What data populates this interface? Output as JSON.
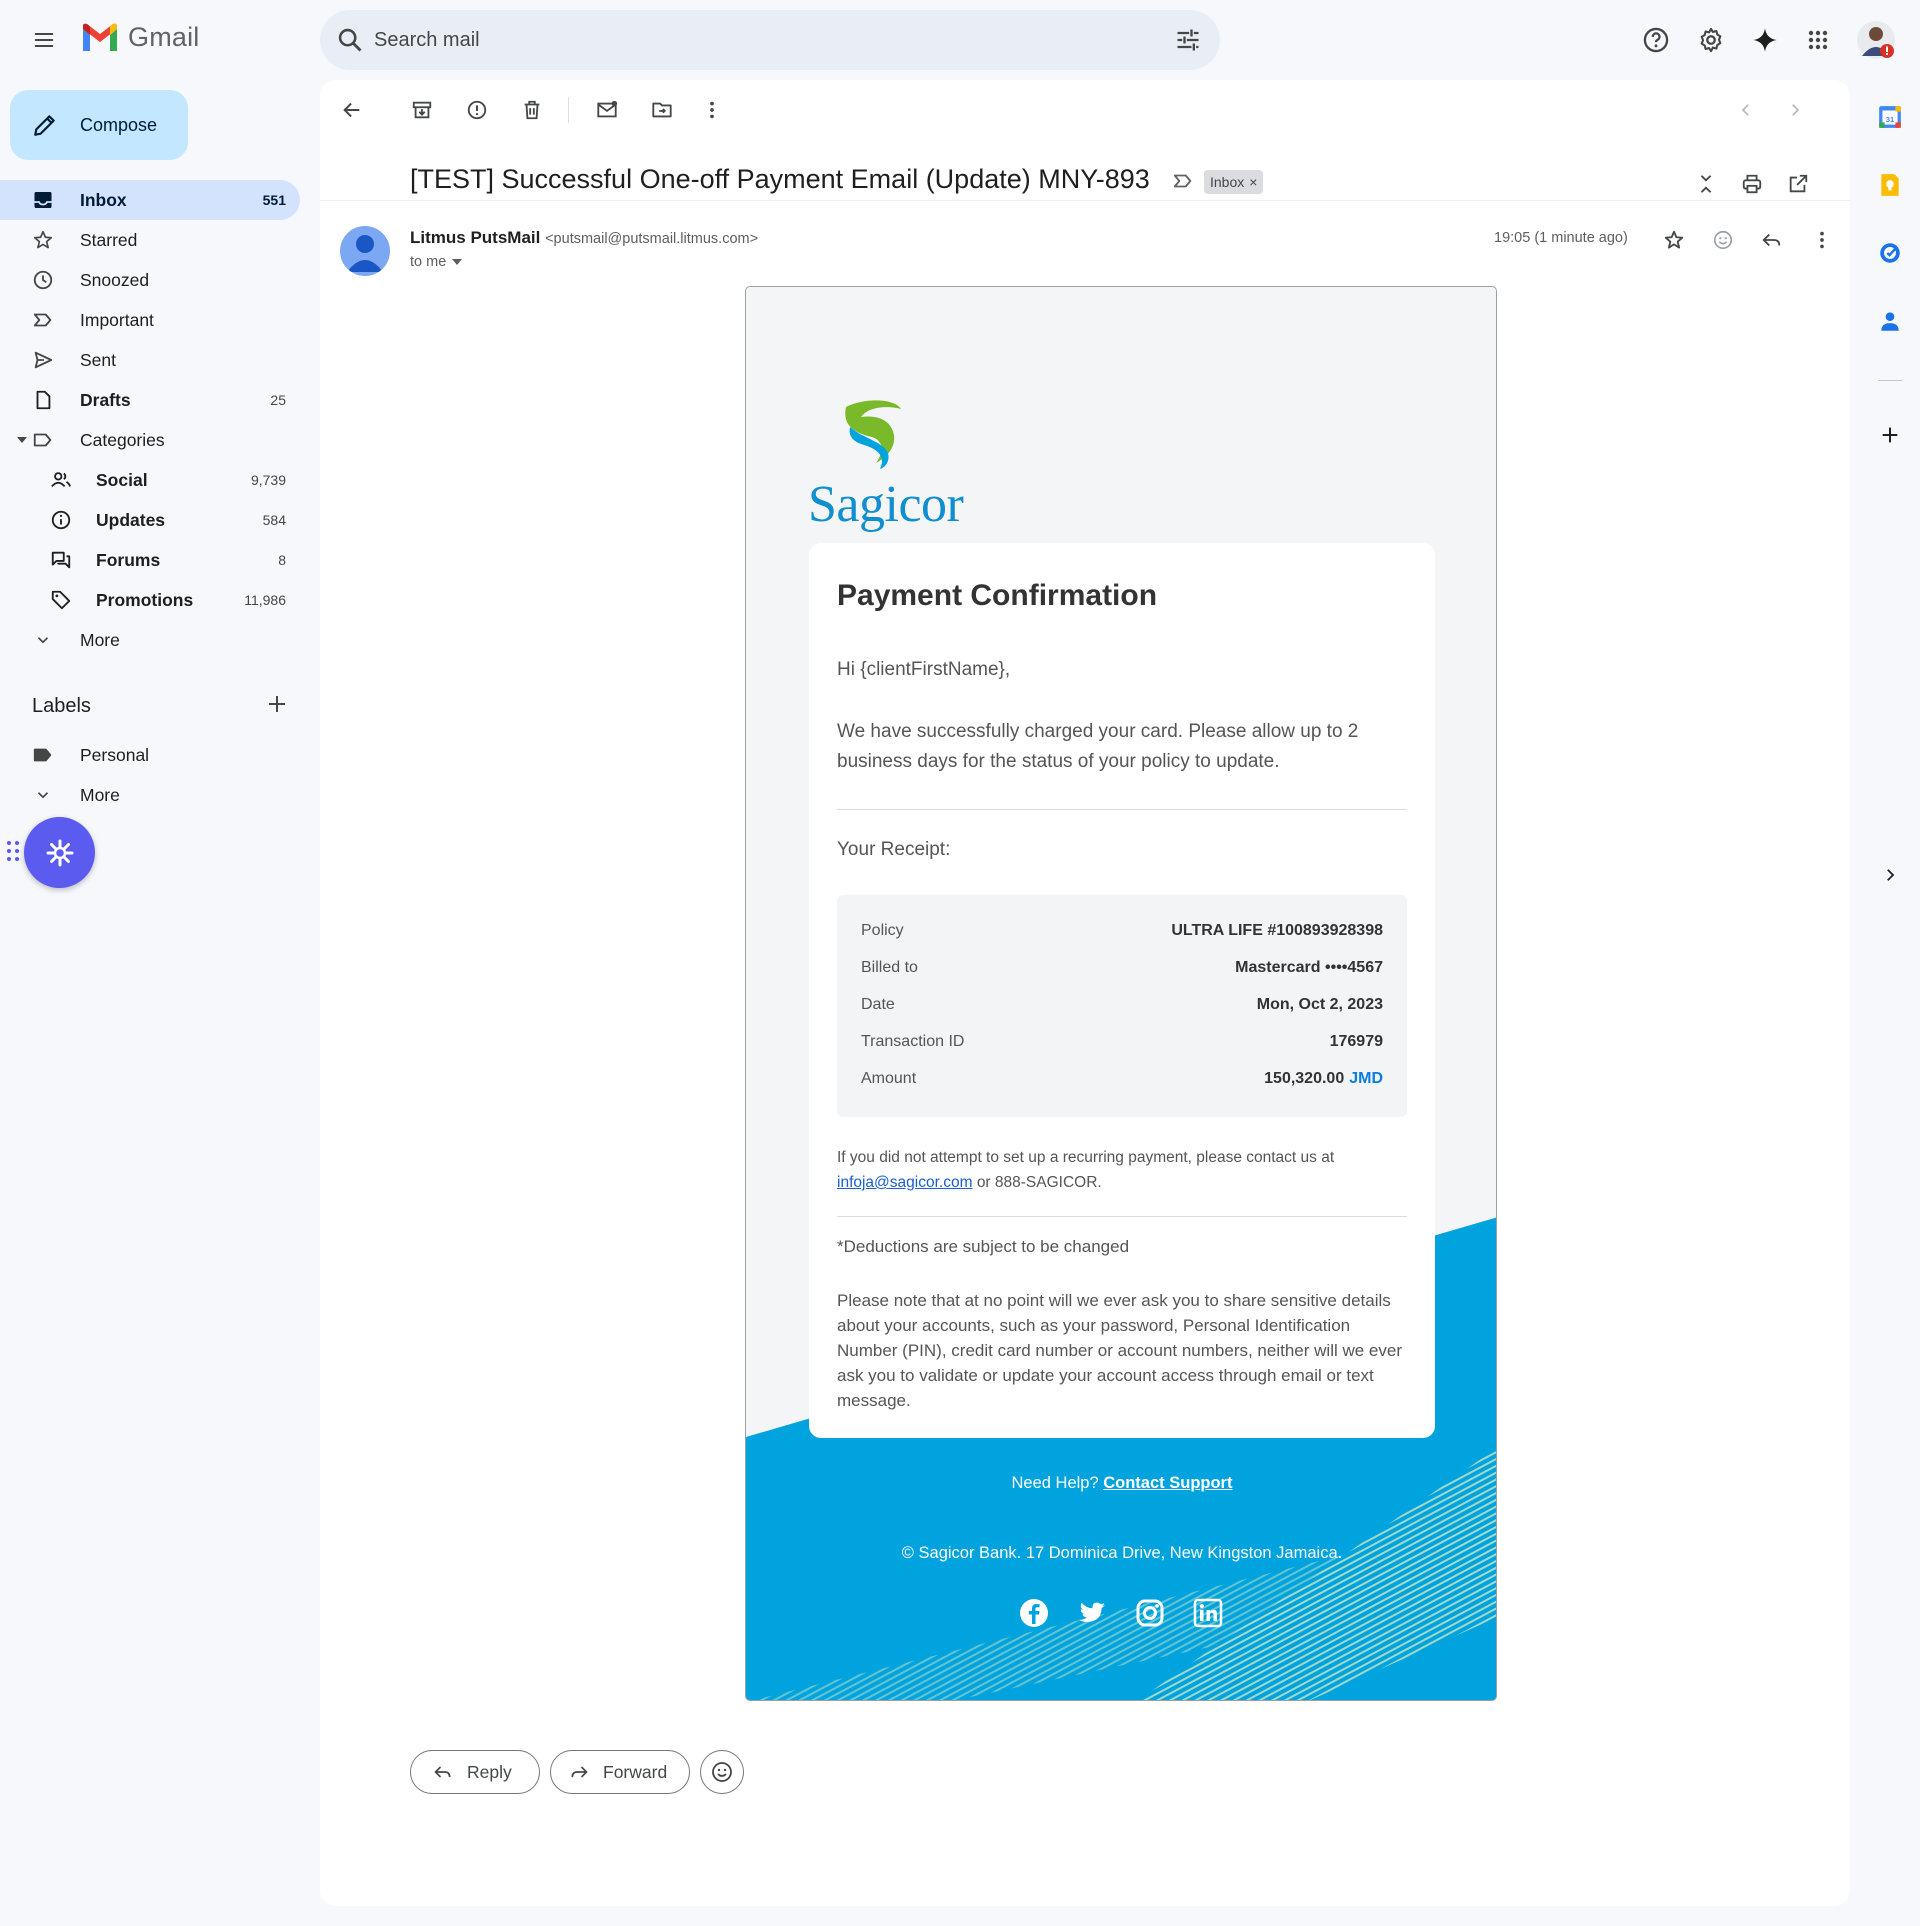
{
  "app": {
    "name": "Gmail"
  },
  "search": {
    "placeholder": "Search mail"
  },
  "compose": {
    "label": "Compose"
  },
  "nav": {
    "inbox": {
      "label": "Inbox",
      "count": "551"
    },
    "starred": {
      "label": "Starred"
    },
    "snoozed": {
      "label": "Snoozed"
    },
    "important": {
      "label": "Important"
    },
    "sent": {
      "label": "Sent"
    },
    "drafts": {
      "label": "Drafts",
      "count": "25"
    },
    "categories": {
      "label": "Categories"
    },
    "social": {
      "label": "Social",
      "count": "9,739"
    },
    "updates": {
      "label": "Updates",
      "count": "584"
    },
    "forums": {
      "label": "Forums",
      "count": "8"
    },
    "promotions": {
      "label": "Promotions",
      "count": "11,986"
    },
    "more": {
      "label": "More"
    }
  },
  "labels": {
    "title": "Labels",
    "items": [
      {
        "label": "Personal"
      }
    ],
    "more": "More"
  },
  "message": {
    "subject": "[TEST] Successful One-off Payment Email (Update) MNY-893",
    "chip": "Inbox",
    "sender_name": "Litmus PutsMail",
    "sender_email": "<putsmail@putsmail.litmus.com>",
    "to": "to me",
    "time": "19:05 (1 minute ago)"
  },
  "email": {
    "brand": "Sagicor",
    "heading": "Payment Confirmation",
    "greeting": "Hi {clientFirstName},",
    "body": "We have successfully charged your card. Please allow up to 2 business days for the status of your policy to update.",
    "receipt_title": "Your Receipt:",
    "receipt": [
      {
        "key": "Policy",
        "value": "ULTRA LIFE #100893928398"
      },
      {
        "key": "Billed to",
        "value": "Mastercard ••••4567"
      },
      {
        "key": "Date",
        "value": "Mon, Oct 2, 2023"
      },
      {
        "key": "Transaction ID",
        "value": "176979"
      },
      {
        "key": "Amount",
        "value": "150,320.00",
        "currency": "JMD"
      }
    ],
    "contact_pre": "If you did not attempt to set up a recurring payment, please contact us at",
    "contact_email": "infoja@sagicor.com",
    "contact_post": "or 888-SAGICOR.",
    "deductions": "*Deductions are subject to be changed",
    "security_note": "Please note that at no point will we ever ask you to share sensitive details about your accounts, such as your password, Personal Identification Number (PIN), credit card number or account numbers, neither will we ever ask you to validate or update your account access through email or text message.",
    "help_pre": "Need Help?",
    "help_link": "Contact Support",
    "footer": "© Sagicor Bank. 17 Dominica Drive, New Kingston Jamaica.",
    "social_icons": [
      "facebook-icon",
      "twitter-icon",
      "instagram-icon",
      "linkedin-icon"
    ],
    "colors": {
      "brand_blue": "#00a3de",
      "brand_green": "#7ab929",
      "link_blue": "#0a7de0"
    }
  },
  "actions": {
    "reply": "Reply",
    "forward": "Forward"
  },
  "colors": {
    "compose_bg": "#c2e7ff",
    "active_nav": "#d3e3fd",
    "page_bg": "#f6f8fc"
  }
}
